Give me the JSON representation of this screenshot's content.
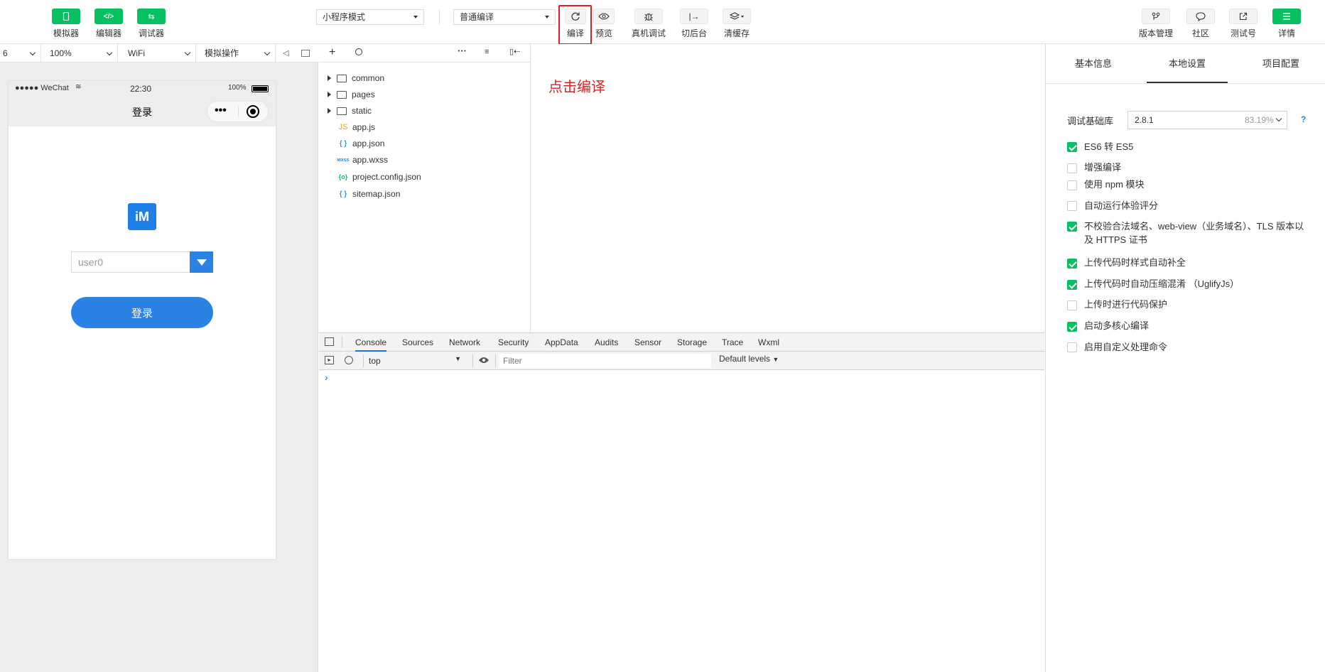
{
  "toolbar": {
    "left_buttons": [
      {
        "label": "模拟器",
        "icon": "phone-icon"
      },
      {
        "label": "编辑器",
        "icon": "code-icon"
      },
      {
        "label": "调试器",
        "icon": "debug-icon"
      }
    ],
    "mode_select": "小程序模式",
    "compile_select": "普通编译",
    "mid_buttons": [
      {
        "label": "编译",
        "icon": "refresh-icon"
      },
      {
        "label": "预览",
        "icon": "eye-icon"
      },
      {
        "label": "真机调试",
        "icon": "bug-icon"
      },
      {
        "label": "切后台",
        "icon": "switch-icon"
      },
      {
        "label": "清缓存",
        "icon": "layers-icon"
      }
    ],
    "right_buttons": [
      {
        "label": "版本管理",
        "icon": "branch-icon"
      },
      {
        "label": "社区",
        "icon": "chat-icon"
      },
      {
        "label": "测试号",
        "icon": "external-link-icon"
      },
      {
        "label": "详情",
        "icon": "menu-icon"
      }
    ]
  },
  "simbar": {
    "device": "6",
    "zoom": "100%",
    "network": "WiFi",
    "sim_ops": "模拟操作"
  },
  "phone": {
    "carrier": "●●●●● WeChat",
    "time": "22:30",
    "battery": "100%",
    "title": "登录",
    "logo_text": "iM",
    "username_value": "user0",
    "login_button": "登录"
  },
  "files": [
    {
      "name": "common",
      "type": "folder"
    },
    {
      "name": "pages",
      "type": "folder"
    },
    {
      "name": "static",
      "type": "folder"
    },
    {
      "name": "app.js",
      "type": "js",
      "badge": "JS",
      "color": "#e6a817"
    },
    {
      "name": "app.json",
      "type": "json",
      "badge": "{ }",
      "color": "#2a9fd6"
    },
    {
      "name": "app.wxss",
      "type": "wxss",
      "badge": "wxss",
      "color": "#2a82e4"
    },
    {
      "name": "project.config.json",
      "type": "config",
      "badge": "{o}",
      "color": "#07c160"
    },
    {
      "name": "sitemap.json",
      "type": "json",
      "badge": "{ }",
      "color": "#2a9fd6"
    }
  ],
  "editor_note": "点击编译",
  "devtools": {
    "tabs": [
      "Console",
      "Sources",
      "Network",
      "Security",
      "AppData",
      "Audits",
      "Sensor",
      "Storage",
      "Trace",
      "Wxml"
    ],
    "active_tab": "Console",
    "context": "top",
    "filter_placeholder": "Filter",
    "levels": "Default levels",
    "prompt": "›"
  },
  "right_panel": {
    "tabs": [
      "基本信息",
      "本地设置",
      "项目配置"
    ],
    "active_tab": "本地设置",
    "lib_label": "调试基础库",
    "lib_version": "2.8.1",
    "lib_percent": "83.19%",
    "help": "?",
    "options": [
      {
        "label": "ES6 转 ES5",
        "checked": true
      },
      {
        "label": "增强编译",
        "checked": false
      },
      {
        "label": "使用 npm 模块",
        "checked": false
      },
      {
        "label": "自动运行体验评分",
        "checked": false
      },
      {
        "label": "不校验合法域名、web-view（业务域名）、TLS 版本以及 HTTPS 证书",
        "checked": true
      },
      {
        "label": "上传代码时样式自动补全",
        "checked": true
      },
      {
        "label": "上传代码时自动压缩混淆 （UglifyJs）",
        "checked": true
      },
      {
        "label": "上传时进行代码保护",
        "checked": false
      },
      {
        "label": "启动多核心编译",
        "checked": true
      },
      {
        "label": "启用自定义处理命令",
        "checked": false
      }
    ]
  },
  "colors": {
    "wechat_green": "#07c160",
    "primary_blue": "#2a82e4",
    "highlight_red": "#e02020"
  }
}
